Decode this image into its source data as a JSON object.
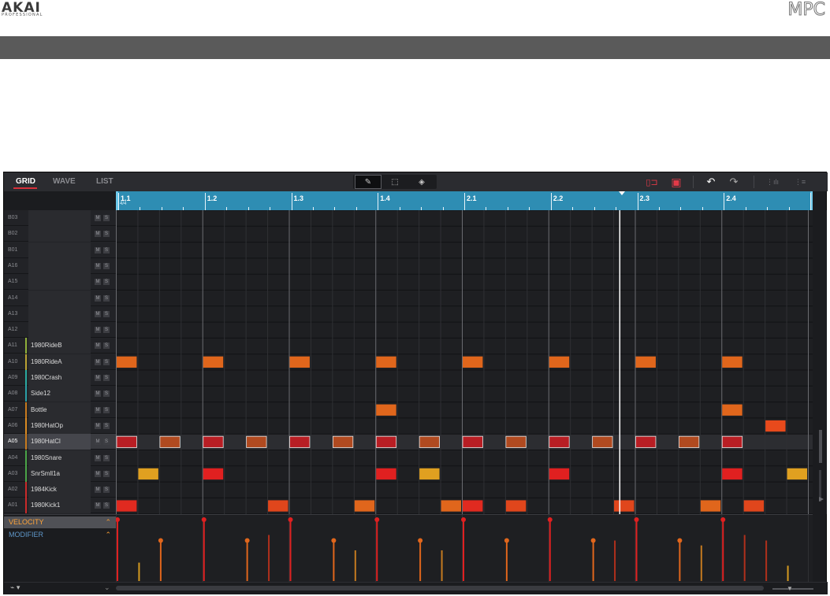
{
  "page_header": {
    "brand_left": "AKAI",
    "brand_left_sub": "PROFESSIONAL",
    "brand_right": "MPC"
  },
  "toolbar": {
    "tabs": [
      {
        "label": "GRID",
        "active": true
      },
      {
        "label": "WAVE",
        "active": false
      },
      {
        "label": "LIST",
        "active": false
      }
    ],
    "tools": [
      {
        "icon": "pencil-icon",
        "glyph": "✎",
        "active": true
      },
      {
        "icon": "select-box-icon",
        "glyph": "⬚",
        "active": false
      },
      {
        "icon": "eraser-icon",
        "glyph": "◈",
        "active": false
      }
    ],
    "right_icons": [
      {
        "name": "loop-locate-icon",
        "glyph": "▯⊐",
        "color": "#e23a48"
      },
      {
        "name": "autoscroll-icon",
        "glyph": "▣",
        "color": "#e23a48"
      },
      {
        "name": "undo-icon",
        "glyph": "↶",
        "color": "#ffffff"
      },
      {
        "name": "redo-icon",
        "glyph": "↷",
        "color": "#aaaaaa"
      },
      {
        "name": "timing-correct-icon",
        "glyph": "⋮ılı",
        "color": "#6d6e73"
      },
      {
        "name": "quantize-icon",
        "glyph": "⋮≡",
        "color": "#6d6e73"
      }
    ]
  },
  "ruler": {
    "time_signature": "4/4",
    "bars": [
      "1.1",
      "1.2",
      "1.3",
      "1.4",
      "2.1",
      "2.2",
      "2.3",
      "2.4"
    ]
  },
  "tracks": [
    {
      "id": "B03",
      "name": "",
      "color": "",
      "selected": false
    },
    {
      "id": "B02",
      "name": "",
      "color": "",
      "selected": false
    },
    {
      "id": "B01",
      "name": "",
      "color": "",
      "selected": false
    },
    {
      "id": "A16",
      "name": "",
      "color": "",
      "selected": false
    },
    {
      "id": "A15",
      "name": "",
      "color": "",
      "selected": false
    },
    {
      "id": "A14",
      "name": "",
      "color": "",
      "selected": false
    },
    {
      "id": "A13",
      "name": "",
      "color": "",
      "selected": false
    },
    {
      "id": "A12",
      "name": "",
      "color": "",
      "selected": false
    },
    {
      "id": "A11",
      "name": "1980RideB",
      "color": "#8fb03a",
      "selected": false
    },
    {
      "id": "A10",
      "name": "1980RideA",
      "color": "#b9a233",
      "selected": false
    },
    {
      "id": "A09",
      "name": "1980Crash",
      "color": "#2aa9a0",
      "selected": false
    },
    {
      "id": "A08",
      "name": "Side12",
      "color": "#2a9ea6",
      "selected": false
    },
    {
      "id": "A07",
      "name": "Bottle",
      "color": "#c77a1e",
      "selected": false
    },
    {
      "id": "A06",
      "name": "1980HatOp",
      "color": "#d88a22",
      "selected": false
    },
    {
      "id": "A05",
      "name": "1980HatCl",
      "color": "#c77a1e",
      "selected": true
    },
    {
      "id": "A04",
      "name": "1980Snare",
      "color": "#4aa347",
      "selected": false
    },
    {
      "id": "A03",
      "name": "SnrSmll1a",
      "color": "#4aa347",
      "selected": false
    },
    {
      "id": "A02",
      "name": "1984Kick",
      "color": "#c92a2a",
      "selected": false
    },
    {
      "id": "A01",
      "name": "1980Kick1",
      "color": "#c92a2a",
      "selected": false
    }
  ],
  "mute_label": "M",
  "solo_label": "S",
  "grid": {
    "steps": 32,
    "playhead_step": 23.3,
    "notes": [
      {
        "track": "A10",
        "step": 0,
        "color": "#e0661c"
      },
      {
        "track": "A10",
        "step": 4,
        "color": "#e0661c"
      },
      {
        "track": "A10",
        "step": 8,
        "color": "#e0661c"
      },
      {
        "track": "A10",
        "step": 12,
        "color": "#e0661c"
      },
      {
        "track": "A10",
        "step": 16,
        "color": "#e0661c"
      },
      {
        "track": "A10",
        "step": 20,
        "color": "#e0661c"
      },
      {
        "track": "A10",
        "step": 24,
        "color": "#e0661c"
      },
      {
        "track": "A10",
        "step": 28,
        "color": "#e0661c"
      },
      {
        "track": "A07",
        "step": 12,
        "color": "#e0661c"
      },
      {
        "track": "A07",
        "step": 28,
        "color": "#e0661c"
      },
      {
        "track": "A06",
        "step": 30,
        "color": "#e84a1c"
      },
      {
        "track": "A05",
        "step": 0,
        "color": "#b81e24"
      },
      {
        "track": "A05",
        "step": 2,
        "color": "#b04a20"
      },
      {
        "track": "A05",
        "step": 4,
        "color": "#b81e24"
      },
      {
        "track": "A05",
        "step": 6,
        "color": "#b04a20"
      },
      {
        "track": "A05",
        "step": 8,
        "color": "#b81e24"
      },
      {
        "track": "A05",
        "step": 10,
        "color": "#b04a20"
      },
      {
        "track": "A05",
        "step": 12,
        "color": "#b81e24"
      },
      {
        "track": "A05",
        "step": 14,
        "color": "#b04a20"
      },
      {
        "track": "A05",
        "step": 16,
        "color": "#b81e24"
      },
      {
        "track": "A05",
        "step": 18,
        "color": "#b04a20"
      },
      {
        "track": "A05",
        "step": 20,
        "color": "#b81e24"
      },
      {
        "track": "A05",
        "step": 22,
        "color": "#b04a20"
      },
      {
        "track": "A05",
        "step": 24,
        "color": "#b81e24"
      },
      {
        "track": "A05",
        "step": 26,
        "color": "#b04a20"
      },
      {
        "track": "A05",
        "step": 28,
        "color": "#b81e24"
      },
      {
        "track": "A03",
        "step": 1,
        "color": "#e0a020"
      },
      {
        "track": "A03",
        "step": 4,
        "color": "#e02020"
      },
      {
        "track": "A03",
        "step": 12,
        "color": "#e02020"
      },
      {
        "track": "A03",
        "step": 14,
        "color": "#e0a020"
      },
      {
        "track": "A03",
        "step": 20,
        "color": "#e02020"
      },
      {
        "track": "A03",
        "step": 28,
        "color": "#e02020"
      },
      {
        "track": "A03",
        "step": 31,
        "color": "#e0a020"
      },
      {
        "track": "A01",
        "step": 0,
        "color": "#e02a20"
      },
      {
        "track": "A01",
        "step": 7,
        "color": "#e0461c"
      },
      {
        "track": "A01",
        "step": 11,
        "color": "#e0661c"
      },
      {
        "track": "A01",
        "step": 15,
        "color": "#e0661c"
      },
      {
        "track": "A01",
        "step": 16,
        "color": "#e02a20"
      },
      {
        "track": "A01",
        "step": 18,
        "color": "#e0461c"
      },
      {
        "track": "A01",
        "step": 23,
        "color": "#e0461c"
      },
      {
        "track": "A01",
        "step": 27,
        "color": "#e0661c"
      },
      {
        "track": "A01",
        "step": 29,
        "color": "#e0461c"
      }
    ]
  },
  "lanes": [
    {
      "label": "VELOCITY",
      "active": true
    },
    {
      "label": "MODIFIER",
      "active": false
    }
  ],
  "velocity_events": [
    {
      "step": 0,
      "level": 1.0,
      "color": "#e02020",
      "dot": true
    },
    {
      "step": 1,
      "level": 0.3,
      "color": "#d49a20",
      "dot": false
    },
    {
      "step": 2,
      "level": 0.66,
      "color": "#e0661c",
      "dot": true
    },
    {
      "step": 4,
      "level": 1.0,
      "color": "#e02020",
      "dot": true
    },
    {
      "step": 6,
      "level": 0.66,
      "color": "#e0661c",
      "dot": true
    },
    {
      "step": 7,
      "level": 0.75,
      "color": "#b0301c",
      "dot": false
    },
    {
      "step": 8,
      "level": 1.0,
      "color": "#e02020",
      "dot": true
    },
    {
      "step": 10,
      "level": 0.66,
      "color": "#e0661c",
      "dot": true
    },
    {
      "step": 11,
      "level": 0.5,
      "color": "#c47a20",
      "dot": false
    },
    {
      "step": 12,
      "level": 1.0,
      "color": "#e02020",
      "dot": true
    },
    {
      "step": 14,
      "level": 0.66,
      "color": "#e0661c",
      "dot": true
    },
    {
      "step": 15,
      "level": 0.5,
      "color": "#c47a20",
      "dot": false
    },
    {
      "step": 16,
      "level": 1.0,
      "color": "#e02020",
      "dot": true
    },
    {
      "step": 18,
      "level": 0.66,
      "color": "#e0661c",
      "dot": true
    },
    {
      "step": 20,
      "level": 1.0,
      "color": "#e02020",
      "dot": true
    },
    {
      "step": 22,
      "level": 0.66,
      "color": "#e0661c",
      "dot": true
    },
    {
      "step": 23,
      "level": 0.66,
      "color": "#b0301c",
      "dot": false
    },
    {
      "step": 24,
      "level": 1.0,
      "color": "#e02020",
      "dot": true
    },
    {
      "step": 26,
      "level": 0.66,
      "color": "#e0661c",
      "dot": true
    },
    {
      "step": 27,
      "level": 0.58,
      "color": "#c47a20",
      "dot": false
    },
    {
      "step": 28,
      "level": 1.0,
      "color": "#e02020",
      "dot": true
    },
    {
      "step": 29,
      "level": 0.75,
      "color": "#b0301c",
      "dot": false
    },
    {
      "step": 30,
      "level": 0.66,
      "color": "#b0301c",
      "dot": false
    },
    {
      "step": 31,
      "level": 0.25,
      "color": "#d49a20",
      "dot": false
    }
  ]
}
